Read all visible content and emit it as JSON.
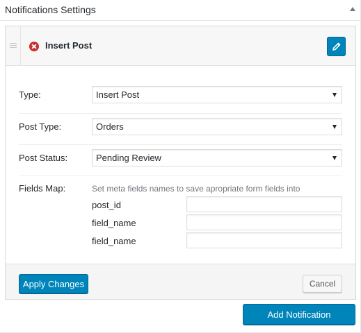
{
  "panel": {
    "title": "Notifications Settings"
  },
  "notification": {
    "title": "Insert Post",
    "fields": {
      "type_label": "Type:",
      "type_value": "Insert Post",
      "post_type_label": "Post Type:",
      "post_type_value": "Orders",
      "post_status_label": "Post Status:",
      "post_status_value": "Pending Review",
      "fields_map_label": "Fields Map:",
      "fields_map_description": "Set meta fields names to save apropriate form fields into"
    },
    "map_rows": [
      {
        "label": "post_id",
        "value": ""
      },
      {
        "label": "field_name",
        "value": ""
      },
      {
        "label": "field_name",
        "value": ""
      }
    ],
    "apply_label": "Apply Changes",
    "cancel_label": "Cancel"
  },
  "add_label": "Add Notification",
  "colors": {
    "primary": "#0085ba",
    "error": "#c9302c"
  },
  "icons": {
    "status": "error-circle-icon",
    "edit": "pencil-icon",
    "drag": "drag-handle-icon",
    "collapse": "collapse-arrow-icon"
  }
}
